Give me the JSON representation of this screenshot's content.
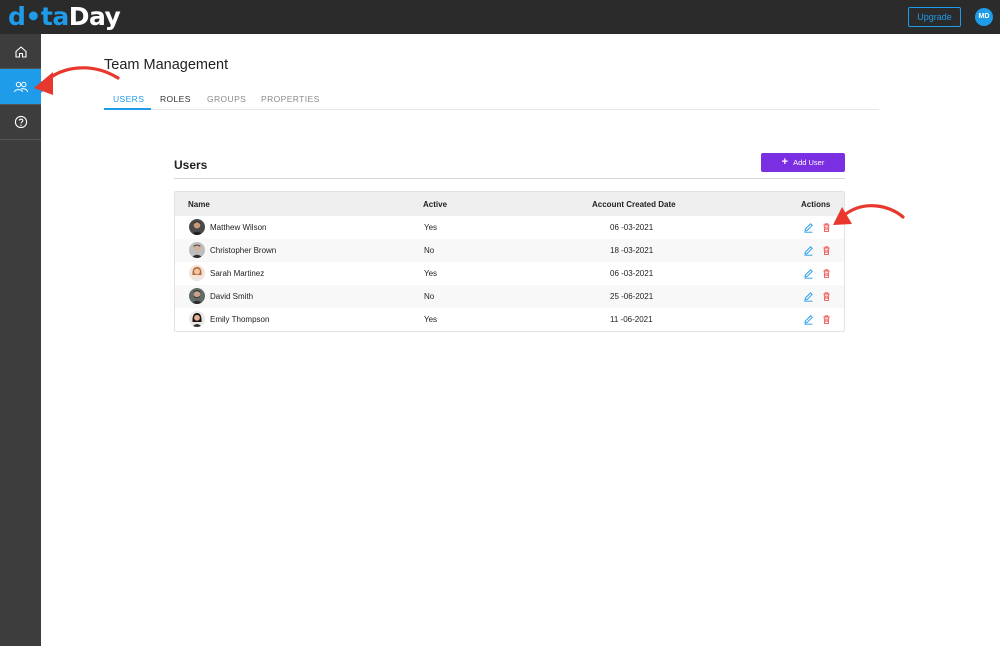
{
  "app": {
    "logo_part1": "d•ta",
    "logo_part2": "Day",
    "upgrade_label": "Upgrade",
    "avatar_initials": "MD",
    "brand_color": "#1e9be9"
  },
  "sidebar": {
    "items": [
      {
        "icon": "home-icon",
        "active": false
      },
      {
        "icon": "users-icon",
        "active": true
      },
      {
        "icon": "help-circle-icon",
        "active": false
      }
    ]
  },
  "page": {
    "title": "Team Management",
    "tabs": [
      {
        "label": "USERS",
        "active": true
      },
      {
        "label": "ROLES",
        "active": false
      },
      {
        "label": "GROUPS",
        "active": false
      },
      {
        "label": "PROPERTIES",
        "active": false
      }
    ]
  },
  "users": {
    "section_title": "Users",
    "add_label": "Add User",
    "add_color": "#7b2fe3",
    "columns": [
      "Name",
      "Active",
      "Account Created Date",
      "Actions"
    ],
    "rows": [
      {
        "name": "Matthew Wilson",
        "active": "Yes",
        "created": "06 -03-2021"
      },
      {
        "name": "Christopher Brown",
        "active": "No",
        "created": "18 -03-2021"
      },
      {
        "name": "Sarah Martinez",
        "active": "Yes",
        "created": "06 -03-2021"
      },
      {
        "name": "David Smith",
        "active": "No",
        "created": "25 -06-2021"
      },
      {
        "name": "Emily Thompson",
        "active": "Yes",
        "created": "11 -06-2021"
      }
    ],
    "action_icons": [
      "edit-pencil-icon",
      "delete-trash-icon"
    ]
  }
}
